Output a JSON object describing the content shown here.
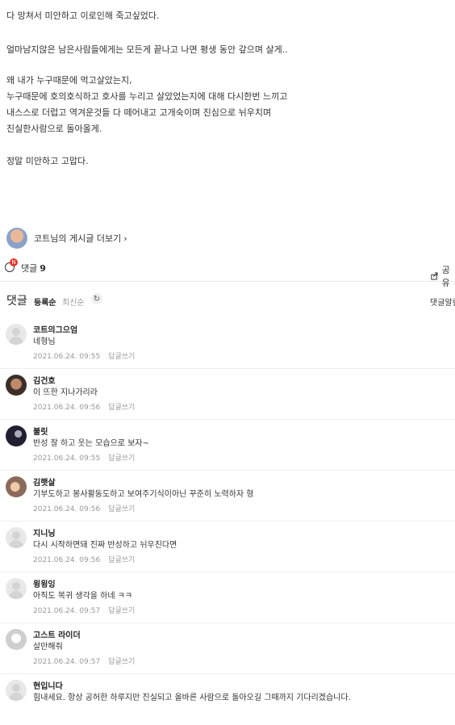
{
  "post": {
    "lines": [
      "다 망쳐서 미안하고 이로인해 죽고싶었다.",
      "얼마남지않은 남은사람들에게는 모든게 끝나고 나면 평생 동안 갚으며 살게..",
      "왜 내가 누구때문에 먹고살았는지,",
      "누구때문에 호의호식하고 호사를 누리고 살았었는지에 대해 다시한번 느끼고",
      "내스스로 더럽고 역겨운것들 다 떼어내고 고개숙이며 진심으로 뉘우치며",
      "진실한사람으로 돌아올게.",
      "정말 미안하고 고맙다."
    ]
  },
  "author": {
    "more_label": "코트님의 게시글 더보기"
  },
  "actions": {
    "comment_label": "댓글",
    "comment_count": "9",
    "new_badge": "N",
    "share_label": "공유"
  },
  "comments_header": {
    "title": "댓글",
    "sort_registered": "등록순",
    "sort_latest": "최신순",
    "notify_label": "댓글알림"
  },
  "comments": [
    {
      "name": "코트의그으엄",
      "text": "네형님",
      "date": "2021.06.24. 09:55",
      "reply": "답글쓰기"
    },
    {
      "name": "김건호",
      "text": "이 뜨한 지나가리라",
      "date": "2021.06.24. 09:56",
      "reply": "답글쓰기"
    },
    {
      "name": "불릿",
      "text": "반성 잘 하고 웃는 모습으로 보자~",
      "date": "2021.06.24. 09:55",
      "reply": "답글쓰기"
    },
    {
      "name": "김햇살",
      "text": "기부도하고 봉사활동도하고 보여주기식이아닌 꾸준히 노력하자 형",
      "date": "2021.06.24. 09:56",
      "reply": "답글쓰기"
    },
    {
      "name": "지니닝",
      "text": "다시 시작하면돼 진짜 반성하고 뉘우친다면",
      "date": "2021.06.24. 09:56",
      "reply": "답글쓰기"
    },
    {
      "name": "윙윙잉",
      "text": "아직도 복귀 생각을 하네 ㅋㅋ",
      "date": "2021.06.24. 09:57",
      "reply": "답글쓰기"
    },
    {
      "name": "고스트 라이더",
      "text": "살만해줘",
      "date": "2021.06.24. 09:57",
      "reply": "답글쓰기"
    },
    {
      "name": "현입니다",
      "text": "힘내세요. 항상 공허한 하루지만 진실되고 올바른 사람으로 돌아오길 그때까지 기다리겠습니다.",
      "date": "",
      "reply": ""
    }
  ]
}
